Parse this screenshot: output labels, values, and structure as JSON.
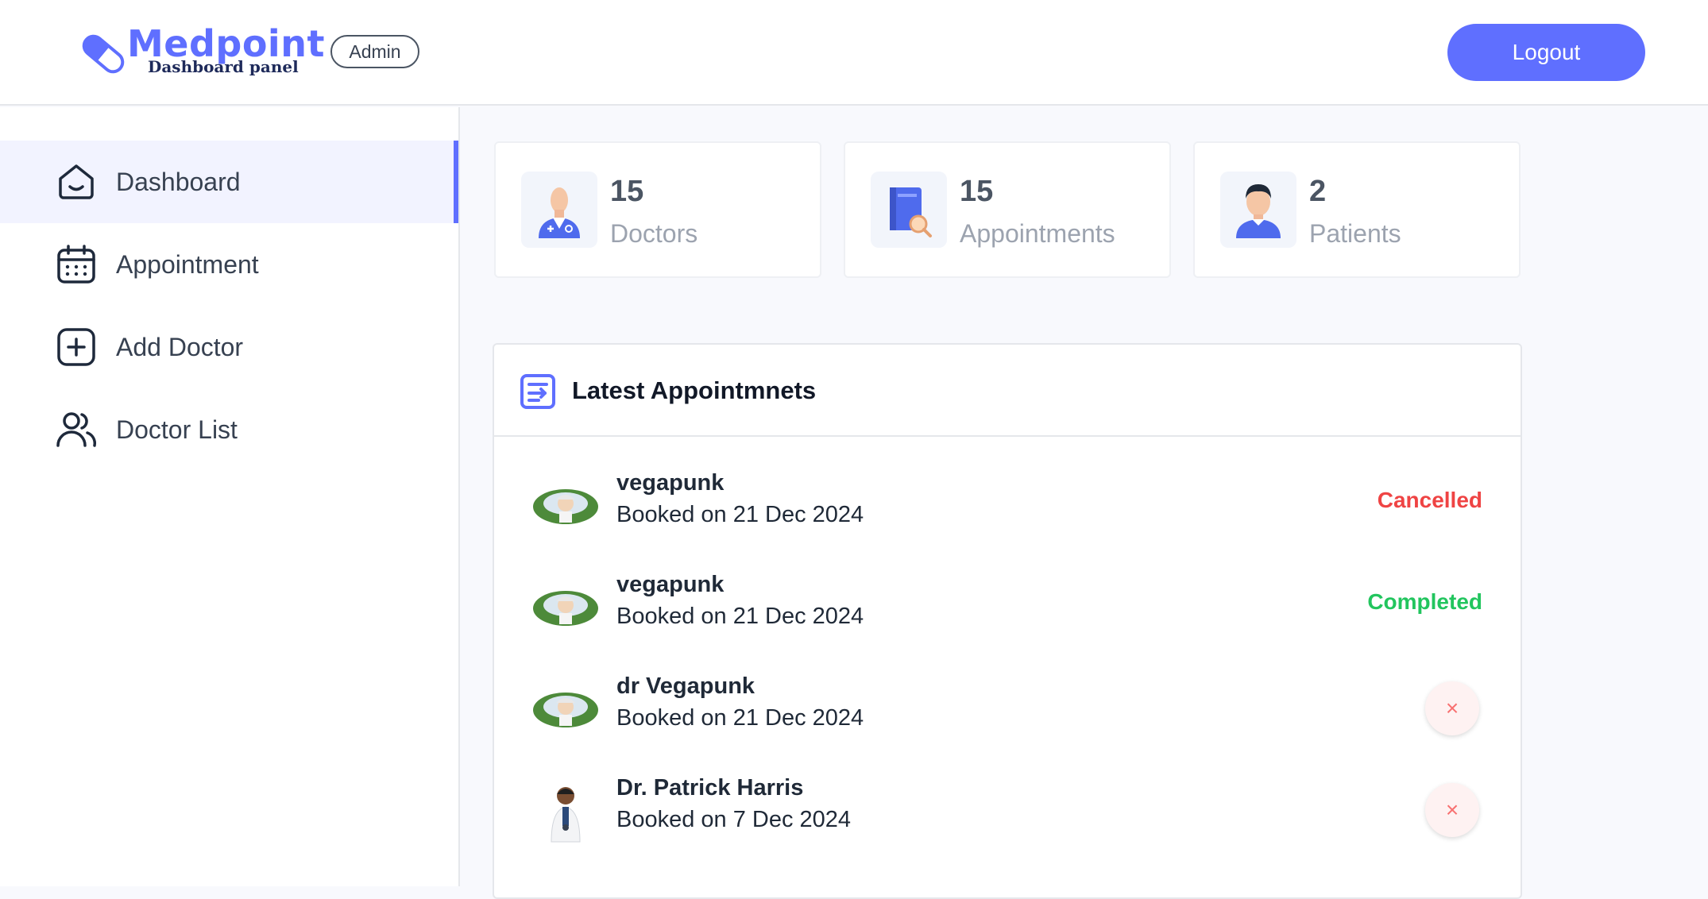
{
  "brand": {
    "name": "Medpoint",
    "subtitle": "Dashboard panel",
    "role_badge": "Admin",
    "color": "#5F6FFF"
  },
  "header": {
    "logout_label": "Logout"
  },
  "sidebar": {
    "items": [
      {
        "label": "Dashboard",
        "icon": "home-icon",
        "active": true
      },
      {
        "label": "Appointment",
        "icon": "calendar-icon",
        "active": false
      },
      {
        "label": "Add Doctor",
        "icon": "add-square-icon",
        "active": false
      },
      {
        "label": "Doctor List",
        "icon": "people-icon",
        "active": false
      }
    ]
  },
  "stats": [
    {
      "value": "15",
      "label": "Doctors",
      "icon": "doctor-icon"
    },
    {
      "value": "15",
      "label": "Appointments",
      "icon": "appointments-book-icon"
    },
    {
      "value": "2",
      "label": "Patients",
      "icon": "patient-icon"
    }
  ],
  "latest": {
    "title": "Latest Appointmnets",
    "icon": "list-icon",
    "rows": [
      {
        "name": "vegapunk",
        "date": "Booked on 21 Dec 2024",
        "status": "Cancelled",
        "status_color": "#ef4444"
      },
      {
        "name": "vegapunk",
        "date": "Booked on 21 Dec 2024",
        "status": "Completed",
        "status_color": "#22C55E"
      },
      {
        "name": "dr Vegapunk",
        "date": "Booked on 21 Dec 2024",
        "action": "×"
      },
      {
        "name": "Dr. Patrick Harris",
        "date": "Booked on 7 Dec 2024",
        "action": "×"
      }
    ]
  }
}
